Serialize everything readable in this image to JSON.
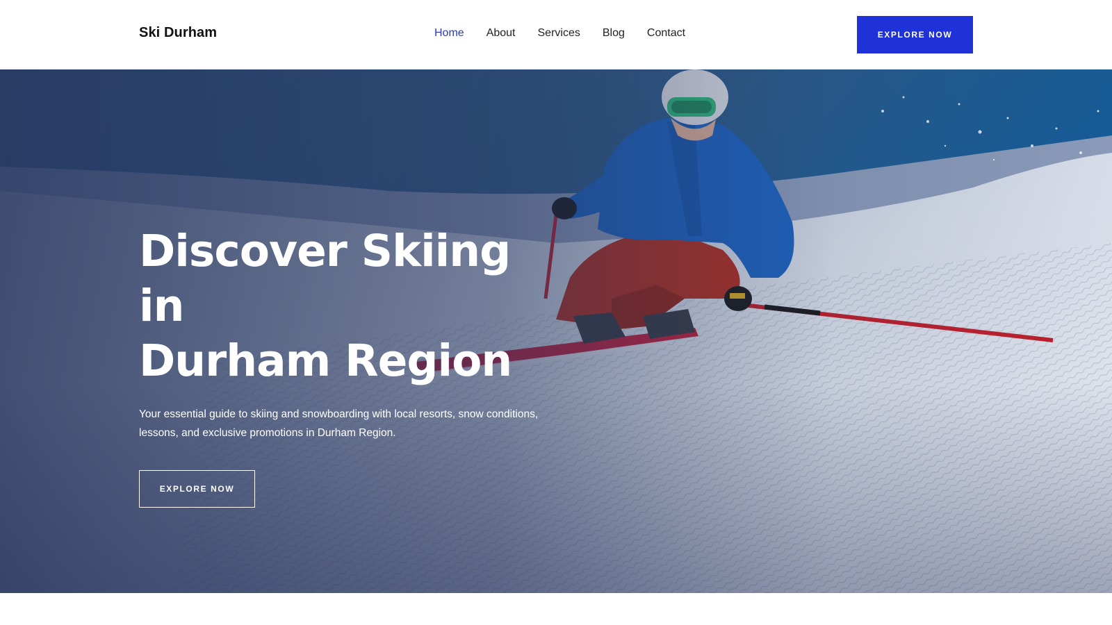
{
  "header": {
    "logo_text": "Ski Durham",
    "nav": [
      {
        "label": "Home",
        "active": true
      },
      {
        "label": "About",
        "active": false
      },
      {
        "label": "Services",
        "active": false
      },
      {
        "label": "Blog",
        "active": false
      },
      {
        "label": "Contact",
        "active": false
      }
    ],
    "cta_label": "EXPLORE NOW"
  },
  "hero": {
    "title_line1": "Discover Skiing in",
    "title_line2": "Durham Region",
    "subtitle": "Your essential guide to skiing and snowboarding with local resorts, snow conditions, lessons, and exclusive promotions in Durham Region.",
    "cta_label": "EXPLORE NOW",
    "image": "skier-on-snow-slope"
  },
  "colors": {
    "accent": "#1f32d8",
    "nav_active": "#2a3bbd",
    "text_dark": "#111111",
    "hero_overlay": "#23325a"
  }
}
